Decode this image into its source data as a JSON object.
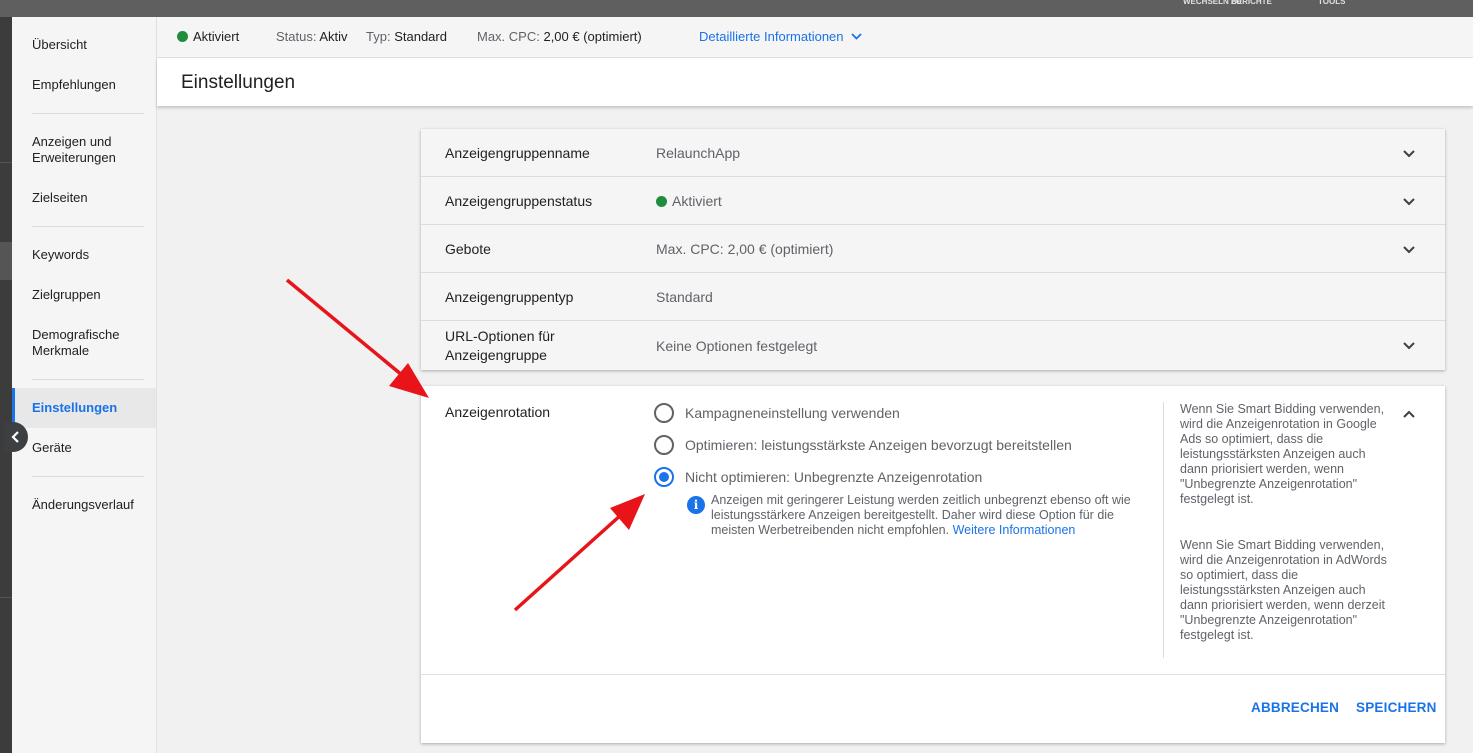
{
  "topbar": {
    "items": [
      "WECHSELN ZU",
      "BERICHTE",
      "TOOLS"
    ]
  },
  "sidebar": {
    "items": [
      {
        "label": "Übersicht"
      },
      {
        "label": "Empfehlungen"
      },
      {
        "label": "Anzeigen und Erweiterungen"
      },
      {
        "label": "Zielseiten"
      },
      {
        "label": "Keywords"
      },
      {
        "label": "Zielgruppen"
      },
      {
        "label": "Demografische Merkmale"
      },
      {
        "label": "Einstellungen"
      },
      {
        "label": "Geräte"
      },
      {
        "label": "Änderungsverlauf"
      }
    ]
  },
  "status": {
    "state": "Aktiviert",
    "status_label": "Status:",
    "status_value": "Aktiv",
    "type_label": "Typ:",
    "type_value": "Standard",
    "cpc_label": "Max. CPC:",
    "cpc_value": "2,00 € (optimiert)",
    "details_link": "Detaillierte Informationen"
  },
  "page": {
    "title": "Einstellungen"
  },
  "settings": {
    "rows": [
      {
        "label": "Anzeigengruppenname",
        "value": "RelaunchApp"
      },
      {
        "label": "Anzeigengruppenstatus",
        "value": "Aktiviert"
      },
      {
        "label": "Gebote",
        "value": "Max. CPC: 2,00 € (optimiert)"
      },
      {
        "label": "Anzeigengruppentyp",
        "value": "Standard"
      },
      {
        "label": "URL-Optionen für Anzeigengruppe",
        "value": "Keine Optionen festgelegt"
      }
    ]
  },
  "rotation": {
    "label": "Anzeigenrotation",
    "options": [
      {
        "label": "Kampagneneinstellung verwenden",
        "checked": false
      },
      {
        "label": "Optimieren: leistungsstärkste Anzeigen bevorzugt bereitstellen",
        "checked": false
      },
      {
        "label": "Nicht optimieren: Unbegrenzte Anzeigenrotation",
        "checked": true
      }
    ],
    "info_text": "Anzeigen mit geringerer Leistung werden zeitlich unbegrenzt ebenso oft wie leistungsstärkere Anzeigen bereitgestellt. Daher wird diese Option für die meisten Werbetreibenden nicht empfohlen.",
    "info_link": "Weitere Informationen",
    "help_1": "Wenn Sie Smart Bidding verwenden, wird die Anzeigenrotation in Google Ads so optimiert, dass die leistungsstärksten Anzeigen auch dann priorisiert werden, wenn \"Unbegrenzte Anzeigenrotation\" festgelegt ist.",
    "help_2": "Wenn Sie Smart Bidding verwenden, wird die Anzeigenrotation in AdWords so optimiert, dass die leistungsstärksten Anzeigen auch dann priorisiert werden, wenn derzeit \"Unbegrenzte Anzeigenrotation\" festgelegt ist.",
    "cancel": "ABBRECHEN",
    "save": "SPEICHERN"
  },
  "colors": {
    "accent": "#1a73e8",
    "active_green": "#1e8e3e",
    "annotation_arrow": "#e8141a"
  },
  "icons": [
    "chevron-down-icon",
    "chevron-up-icon",
    "chevron-left-icon",
    "info-icon",
    "status-dot-icon"
  ]
}
